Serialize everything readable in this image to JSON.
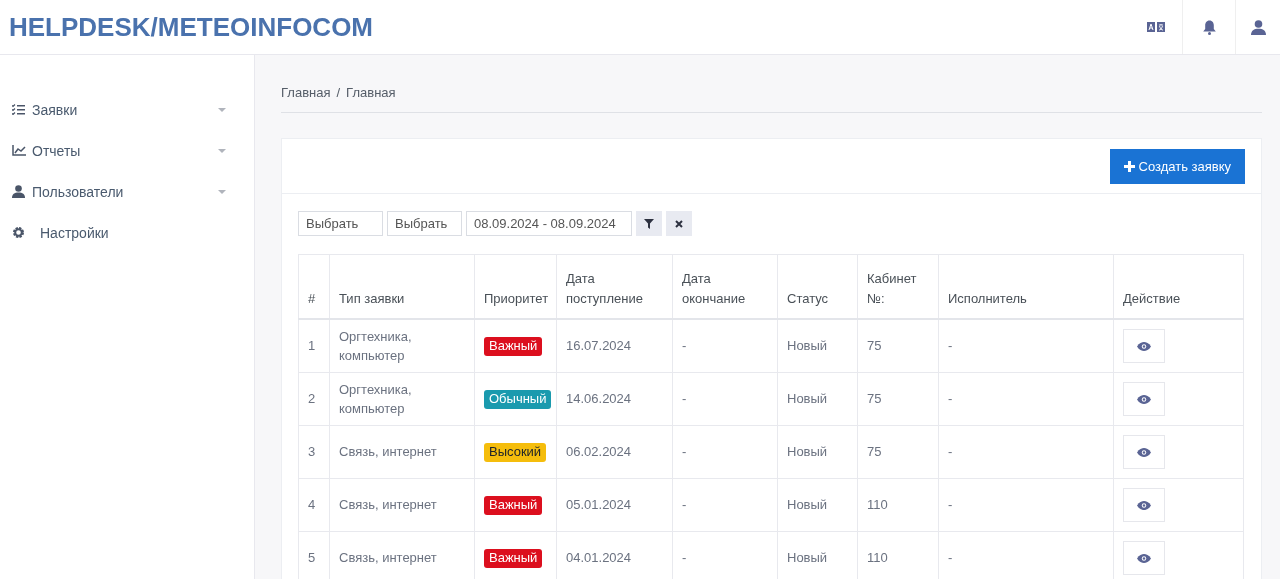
{
  "header": {
    "logo": "HELPDESK/METEOINFOCOM"
  },
  "sidebar": {
    "items": [
      {
        "label": "Заявки",
        "has_submenu": true
      },
      {
        "label": "Отчеты",
        "has_submenu": true
      },
      {
        "label": "Пользователи",
        "has_submenu": true
      },
      {
        "label": "Настройки",
        "has_submenu": false
      }
    ]
  },
  "breadcrumb": [
    "Главная",
    "Главная"
  ],
  "breadcrumb_separator": "/",
  "create_button": "Создать заявку",
  "filters": {
    "type_select": {
      "placeholder": "Выбрать"
    },
    "priority_select": {
      "placeholder": "Выбрать"
    },
    "date_range": {
      "value": "08.09.2024 - 08.09.2024"
    }
  },
  "table": {
    "columns": [
      "#",
      "Тип заявки",
      "Приоритет",
      "Дата поступление",
      "Дата окончание",
      "Статус",
      "Кабинет №:",
      "Исполнитель",
      "Действие"
    ],
    "rows": [
      {
        "number": "1",
        "type": "Оргтехника, компьютер",
        "priority": {
          "label": "Важный",
          "color": "#dc0f1e"
        },
        "received": "16.07.2024",
        "closed": "-",
        "status": "Новый",
        "room": "75",
        "assignee": "-"
      },
      {
        "number": "2",
        "type": "Оргтехника, компьютер",
        "priority": {
          "label": "Обычный",
          "color": "#1a9aae"
        },
        "received": "14.06.2024",
        "closed": "-",
        "status": "Новый",
        "room": "75",
        "assignee": "-"
      },
      {
        "number": "3",
        "type": "Связь, интернет",
        "priority": {
          "label": "Высокий",
          "color": "#f5bd0c"
        },
        "received": "06.02.2024",
        "closed": "-",
        "status": "Новый",
        "room": "75",
        "assignee": "-"
      },
      {
        "number": "4",
        "type": "Связь, интернет",
        "priority": {
          "label": "Важный",
          "color": "#dc0f1e"
        },
        "received": "05.01.2024",
        "closed": "-",
        "status": "Новый",
        "room": "110",
        "assignee": "-"
      },
      {
        "number": "5",
        "type": "Связь, интернет",
        "priority": {
          "label": "Важный",
          "color": "#dc0f1e"
        },
        "received": "04.01.2024",
        "closed": "-",
        "status": "Новый",
        "room": "110",
        "assignee": "-"
      }
    ]
  }
}
